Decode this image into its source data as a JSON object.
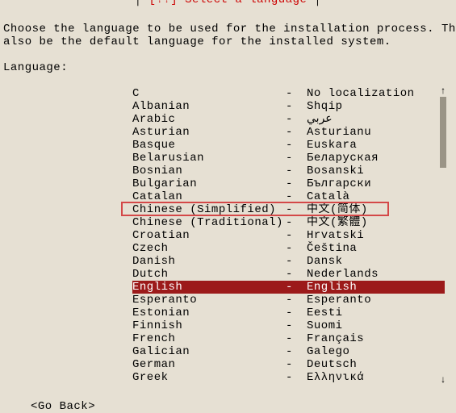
{
  "title": "[!!] Select a language",
  "title_pre": "│ ",
  "title_post": " │",
  "instructions": "Choose the language to be used for the installation process. The select\nalso be the default language for the installed system.",
  "label": "Language:",
  "selected_index": 15,
  "highlighted_index": 9,
  "goback": "<Go Back>",
  "languages": [
    {
      "english": "C",
      "native": "No localization"
    },
    {
      "english": "Albanian",
      "native": "Shqip"
    },
    {
      "english": "Arabic",
      "native": "عربي"
    },
    {
      "english": "Asturian",
      "native": "Asturianu"
    },
    {
      "english": "Basque",
      "native": "Euskara"
    },
    {
      "english": "Belarusian",
      "native": "Беларуская"
    },
    {
      "english": "Bosnian",
      "native": "Bosanski"
    },
    {
      "english": "Bulgarian",
      "native": "Български"
    },
    {
      "english": "Catalan",
      "native": "Català"
    },
    {
      "english": "Chinese (Simplified)",
      "native": "中文(简体)"
    },
    {
      "english": "Chinese (Traditional)",
      "native": "中文(繁體)"
    },
    {
      "english": "Croatian",
      "native": "Hrvatski"
    },
    {
      "english": "Czech",
      "native": "Čeština"
    },
    {
      "english": "Danish",
      "native": "Dansk"
    },
    {
      "english": "Dutch",
      "native": "Nederlands"
    },
    {
      "english": "English",
      "native": "English"
    },
    {
      "english": "Esperanto",
      "native": "Esperanto"
    },
    {
      "english": "Estonian",
      "native": "Eesti"
    },
    {
      "english": "Finnish",
      "native": "Suomi"
    },
    {
      "english": "French",
      "native": "Français"
    },
    {
      "english": "Galician",
      "native": "Galego"
    },
    {
      "english": "German",
      "native": "Deutsch"
    },
    {
      "english": "Greek",
      "native": "Ελληνικά"
    }
  ]
}
